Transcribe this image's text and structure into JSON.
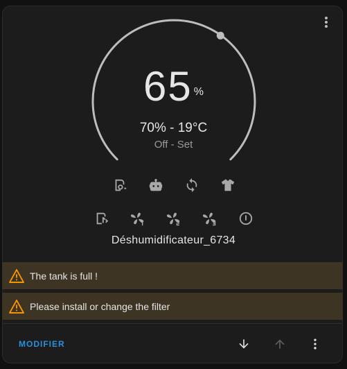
{
  "dial": {
    "current_value": "65",
    "unit": "%",
    "setpoint_fraction": 0.13
  },
  "range_text": "70% - 19°C",
  "status_text": "Off - Set",
  "modes": [
    {
      "icon": "dry-icon"
    },
    {
      "icon": "auto-robot-icon"
    },
    {
      "icon": "continuous-icon"
    },
    {
      "icon": "laundry-tshirt-icon"
    }
  ],
  "fan_controls": [
    {
      "icon": "clothes-dry-icon"
    },
    {
      "icon": "fan-speed-1-icon"
    },
    {
      "icon": "fan-speed-2-icon"
    },
    {
      "icon": "fan-speed-3-icon"
    },
    {
      "icon": "power-icon"
    }
  ],
  "device_name": "Déshumidificateur_6734",
  "alerts": [
    {
      "text": "The tank is full !"
    },
    {
      "text": "Please install or change the filter"
    }
  ],
  "footer": {
    "modify_label": "MODIFIER"
  },
  "colors": {
    "accent": "#2a8fd9",
    "warning": "#ff9800",
    "alert_bg": "#3d3423",
    "card_bg": "#1c1c1c"
  }
}
